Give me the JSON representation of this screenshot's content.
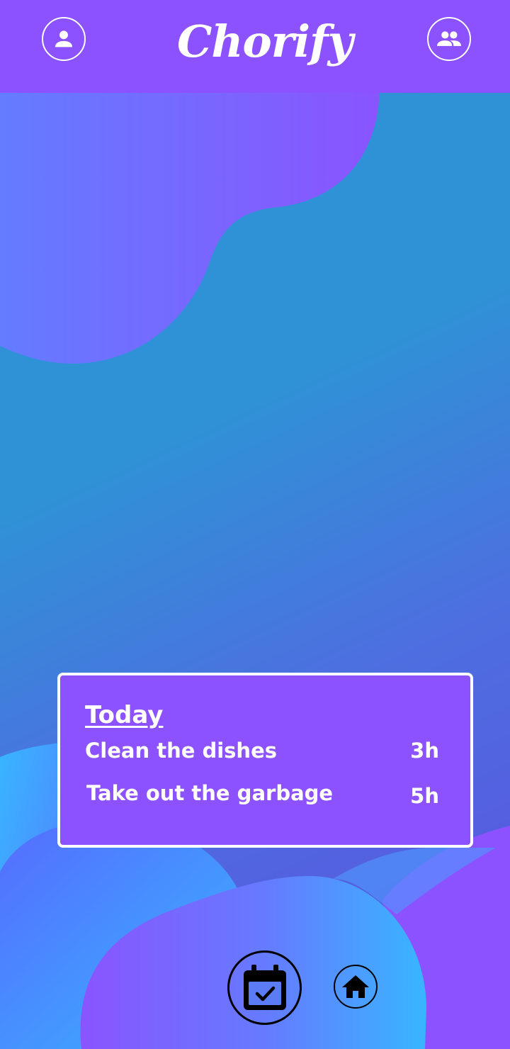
{
  "app": {
    "title": "Chorify"
  },
  "header": {
    "profile_icon": "person-icon",
    "group_icon": "group-icon"
  },
  "today": {
    "title": "Today",
    "chores": [
      {
        "name": "Clean the dishes",
        "time": "3h"
      },
      {
        "name": "Take out the garbage",
        "time": "5h"
      }
    ]
  },
  "bottom_nav": {
    "calendar_icon": "calendar-check-icon",
    "home_icon": "home-icon"
  },
  "colors": {
    "brand_purple": "#8c52ff",
    "background_blue": "#2f8fd6",
    "light_blue": "#38b6ff",
    "white": "#ffffff"
  }
}
